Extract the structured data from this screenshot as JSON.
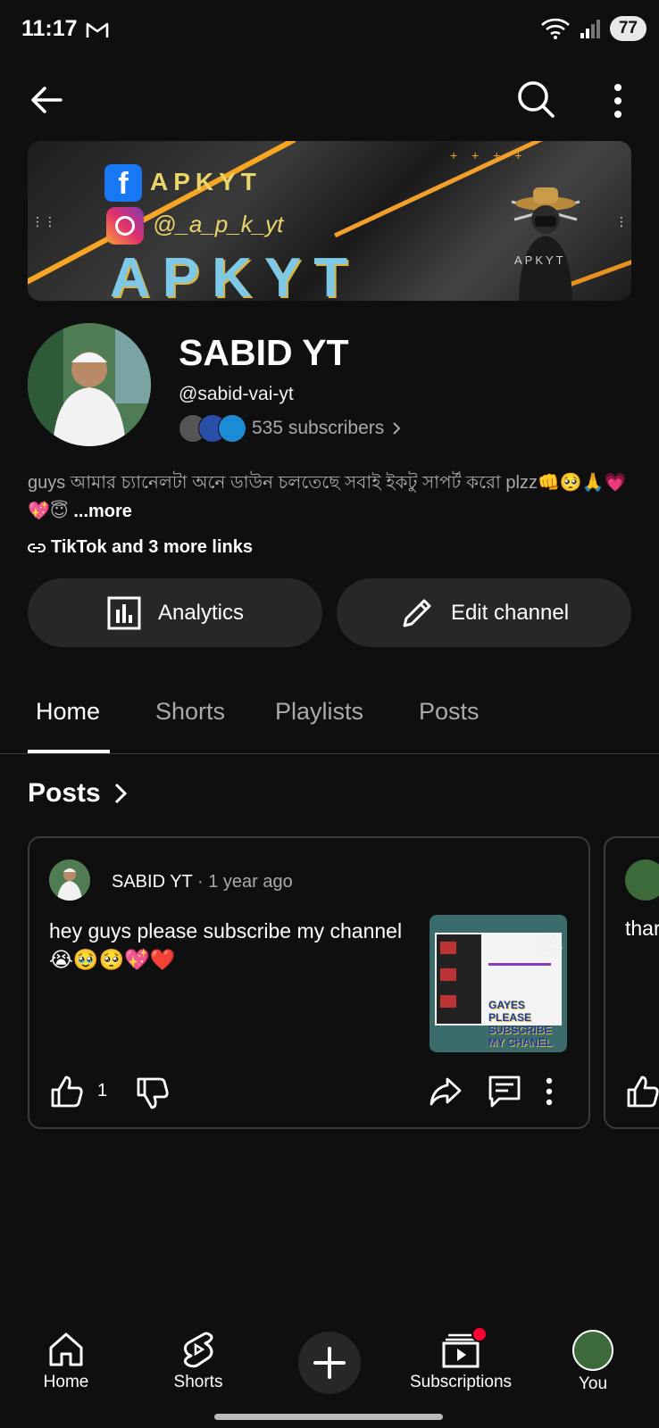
{
  "status_bar": {
    "time": "11:17",
    "battery": "77"
  },
  "banner": {
    "facebook_handle": "APKYT",
    "instagram_handle": "@_a_p_k_yt",
    "brand": "APKYT",
    "figure_label": "APKYT"
  },
  "channel": {
    "name": "SABID YT",
    "handle": "@sabid-vai-yt",
    "subscribers": "535 subscribers",
    "description": "guys আমার চ্যানেলটা অনে ডাউন চলতেছে সবাই ইকটু সাপর্ট করো plzz👊🥺🙏💗💖😇",
    "more_label": "...more",
    "links": "TikTok and 3 more links"
  },
  "buttons": {
    "analytics": "Analytics",
    "edit_channel": "Edit channel"
  },
  "tabs": [
    {
      "label": "Home",
      "active": true
    },
    {
      "label": "Shorts",
      "active": false
    },
    {
      "label": "Playlists",
      "active": false
    },
    {
      "label": "Posts",
      "active": false
    }
  ],
  "posts_section": {
    "title": "Posts",
    "post": {
      "author": "SABID YT",
      "time": " · 1 year ago",
      "text": "hey guys please subscribe my channel 😭🥹🥺💖❤️",
      "image_caption": "GAYES PLEASE SUBSCRIBE MY CHANEL",
      "likes": "1"
    },
    "next_post_preview": "thar"
  },
  "bottom_nav": {
    "home": "Home",
    "shorts": "Shorts",
    "subscriptions": "Subscriptions",
    "you": "You"
  },
  "colors": {
    "background": "#0f0f0f",
    "button": "#272727",
    "accent_red": "#ff0033",
    "muted_text": "#aaaaaa"
  }
}
